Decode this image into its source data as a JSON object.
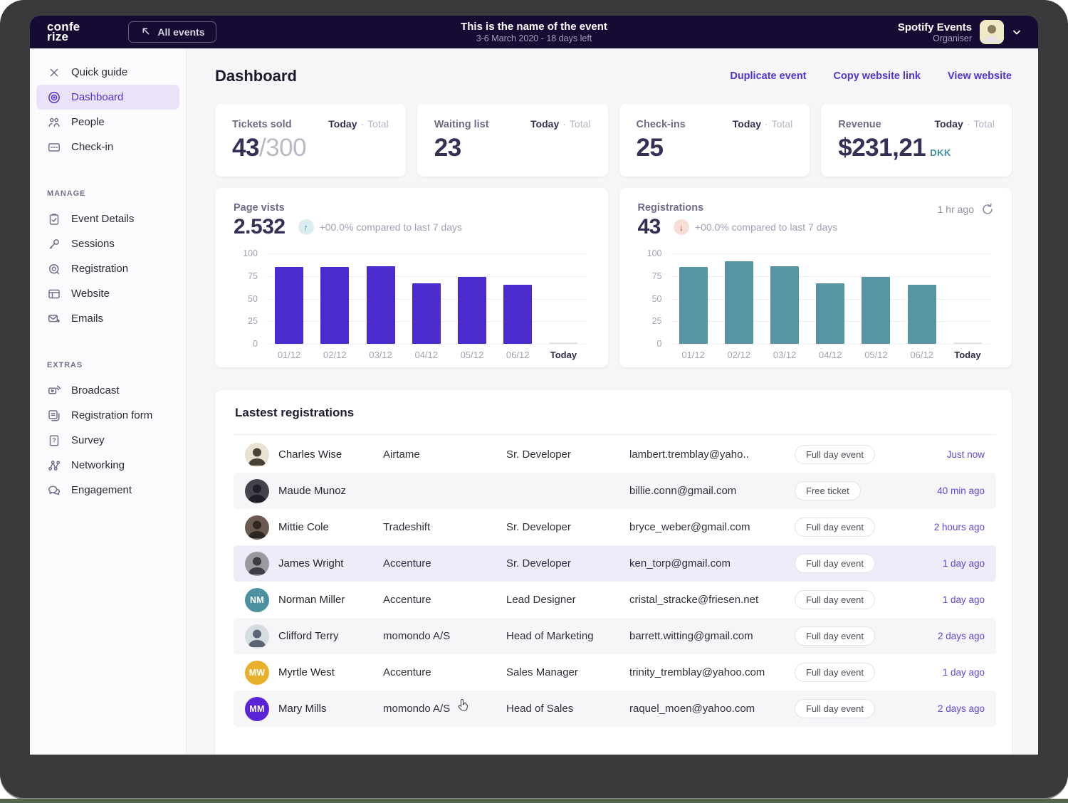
{
  "header": {
    "logo_line1": "confe",
    "logo_line2": "rize",
    "all_events_label": "All events",
    "event_title": "This is the name of the event",
    "event_subtitle": "3-6 March 2020 - 18 days left",
    "org_name": "Spotify Events",
    "org_role": "Organiser"
  },
  "sidebar": {
    "groups": [
      {
        "title": "",
        "items": [
          {
            "label": "Quick guide",
            "icon": "close-icon",
            "active": false
          },
          {
            "label": "Dashboard",
            "icon": "dashboard-icon",
            "active": true
          },
          {
            "label": "People",
            "icon": "people-icon",
            "active": false
          },
          {
            "label": "Check-in",
            "icon": "checkin-icon",
            "active": false
          }
        ]
      },
      {
        "title": "MANAGE",
        "items": [
          {
            "label": "Event Details",
            "icon": "clipboard-icon",
            "active": false
          },
          {
            "label": "Sessions",
            "icon": "microphone-icon",
            "active": false
          },
          {
            "label": "Registration",
            "icon": "ticket-icon",
            "active": false
          },
          {
            "label": "Website",
            "icon": "browser-icon",
            "active": false
          },
          {
            "label": "Emails",
            "icon": "envelope-icon",
            "active": false
          }
        ]
      },
      {
        "title": "EXTRAS",
        "items": [
          {
            "label": "Broadcast",
            "icon": "broadcast-icon",
            "active": false
          },
          {
            "label": "Registration form",
            "icon": "form-icon",
            "active": false
          },
          {
            "label": "Survey",
            "icon": "survey-icon",
            "active": false
          },
          {
            "label": "Networking",
            "icon": "network-icon",
            "active": false
          },
          {
            "label": "Engagement",
            "icon": "chat-icon",
            "active": false
          }
        ]
      }
    ]
  },
  "page": {
    "title": "Dashboard",
    "actions": [
      "Duplicate event",
      "Copy website link",
      "View website"
    ]
  },
  "stats": [
    {
      "label": "Tickets sold",
      "toggle_active": "Today",
      "toggle_inactive": "Total",
      "value": "43",
      "suffix": "/300",
      "currency": ""
    },
    {
      "label": "Waiting list",
      "toggle_active": "Today",
      "toggle_inactive": "Total",
      "value": "23",
      "suffix": "",
      "currency": ""
    },
    {
      "label": "Check-ins",
      "toggle_active": "Today",
      "toggle_inactive": "Total",
      "value": "25",
      "suffix": "",
      "currency": ""
    },
    {
      "label": "Revenue",
      "toggle_active": "Today",
      "toggle_inactive": "Total",
      "value": "$231,21",
      "suffix": "",
      "currency": "DKK"
    }
  ],
  "chart_data": [
    {
      "type": "bar",
      "title": "Page vists",
      "big_number": "2.532",
      "change_direction": "up",
      "change_text": "+00.0% compared to last 7 days",
      "updated": "",
      "categories": [
        "01/12",
        "02/12",
        "03/12",
        "04/12",
        "05/12",
        "06/12",
        "Today"
      ],
      "values": [
        85,
        85,
        86,
        67,
        74,
        65,
        1
      ],
      "yticks": [
        0,
        25,
        50,
        75,
        100
      ],
      "ylim": [
        0,
        100
      ],
      "bar_color": "#4a2bd0",
      "today_color": "#e3e3e8",
      "legend_position": "none",
      "grid": true
    },
    {
      "type": "bar",
      "title": "Registrations",
      "big_number": "43",
      "change_direction": "down",
      "change_text": "+00.0% compared to last 7 days",
      "updated": "1 hr ago",
      "categories": [
        "01/12",
        "02/12",
        "03/12",
        "04/12",
        "05/12",
        "06/12",
        "Today"
      ],
      "values": [
        85,
        91,
        86,
        67,
        74,
        65,
        1
      ],
      "yticks": [
        0,
        25,
        50,
        75,
        100
      ],
      "ylim": [
        0,
        100
      ],
      "bar_color": "#5795a3",
      "today_color": "#e3e3e8",
      "legend_position": "none",
      "grid": true
    }
  ],
  "table": {
    "title": "Lastest registrations",
    "rows": [
      {
        "name": "Charles Wise",
        "company": "Airtame",
        "role": "Sr. Developer",
        "email": "lambert.tremblay@yaho..",
        "badge": "Full day event",
        "time": "Just now",
        "bg": "none",
        "avatar": {
          "kind": "photo",
          "bg": "#e9e2d2",
          "fg": "#4a4038",
          "text": ""
        }
      },
      {
        "name": "Maude Munoz",
        "company": "",
        "role": "",
        "email": "billie.conn@gmail.com",
        "badge": "Free ticket",
        "time": "40 min ago",
        "bg": "stripe",
        "avatar": {
          "kind": "photo",
          "bg": "#46424d",
          "fg": "#201e26",
          "text": ""
        }
      },
      {
        "name": "Mittie Cole",
        "company": "Tradeshift",
        "role": "Sr. Developer",
        "email": "bryce_weber@gmail.com",
        "badge": "Full day event",
        "time": "2 hours ago",
        "bg": "none",
        "avatar": {
          "kind": "photo",
          "bg": "#6b5a50",
          "fg": "#2e2620",
          "text": ""
        }
      },
      {
        "name": "James Wright",
        "company": "Accenture",
        "role": "Sr. Developer",
        "email": "ken_torp@gmail.com",
        "badge": "Full day event",
        "time": "1 day ago",
        "bg": "selected",
        "avatar": {
          "kind": "photo",
          "bg": "#9a9a9e",
          "fg": "#3c3c44",
          "text": ""
        }
      },
      {
        "name": "Norman Miller",
        "company": "Accenture",
        "role": "Lead Designer",
        "email": "cristal_stracke@friesen.net",
        "badge": "Full day event",
        "time": "1 day ago",
        "bg": "none",
        "avatar": {
          "kind": "initials",
          "bg": "#4b91a1",
          "fg": "#ffffff",
          "text": "NM"
        }
      },
      {
        "name": "Clifford Terry",
        "company": "momondo A/S",
        "role": "Head of Marketing",
        "email": "barrett.witting@gmail.com",
        "badge": "Full day event",
        "time": "2 days ago",
        "bg": "stripe",
        "avatar": {
          "kind": "photo",
          "bg": "#d7dce1",
          "fg": "#5a6472",
          "text": ""
        }
      },
      {
        "name": "Myrtle West",
        "company": "Accenture",
        "role": "Sales Manager",
        "email": "trinity_tremblay@yahoo.com",
        "badge": "Full day event",
        "time": "1 day ago",
        "bg": "none",
        "avatar": {
          "kind": "initials",
          "bg": "#e9b02e",
          "fg": "#ffffff",
          "text": "MW"
        }
      },
      {
        "name": "Mary Mills",
        "company": "momondo A/S",
        "role": "Head of Sales",
        "email": "raquel_moen@yahoo.com",
        "badge": "Full day event",
        "time": "2 days ago",
        "bg": "stripe",
        "avatar": {
          "kind": "initials",
          "bg": "#5a23d6",
          "fg": "#ffffff",
          "text": "MM"
        }
      }
    ]
  },
  "colors": {
    "accent_purple": "#4f35d8",
    "topbar_bg": "#160b33",
    "bar_purple": "#4a2bd0",
    "bar_teal": "#5795a3",
    "currency_teal": "#3f8fa0",
    "selected_row": "#efecfa"
  }
}
